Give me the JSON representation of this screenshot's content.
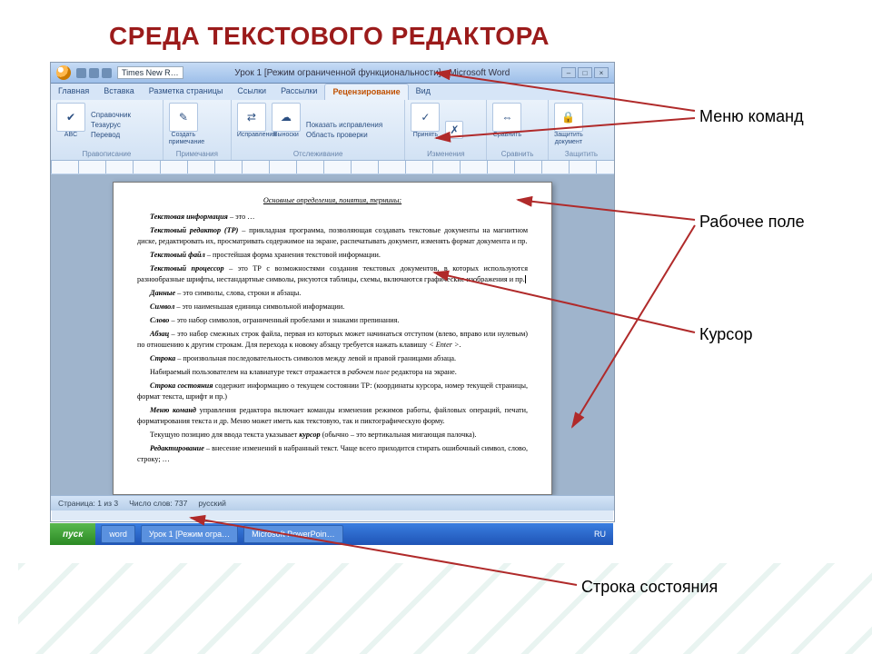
{
  "slide": {
    "title": "СРЕДА ТЕКСТОВОГО РЕДАКТОРА"
  },
  "titlebar": {
    "font_box": "Times New R…",
    "caption": "Урок 1 [Режим ограниченной функциональности] - Microsoft Word"
  },
  "tabs": {
    "items": [
      "Главная",
      "Вставка",
      "Разметка страницы",
      "Ссылки",
      "Рассылки",
      "Рецензирование",
      "Вид"
    ],
    "selected_index": 5
  },
  "ribbon": {
    "groups": [
      {
        "label": "Правописание",
        "items": [
          "ABC",
          "Справочник",
          "Тезаурус",
          "Перевод"
        ]
      },
      {
        "label": "Примечания",
        "items": [
          "Создать примечание"
        ]
      },
      {
        "label": "Отслеживание",
        "items": [
          "Исправления",
          "Выноски",
          "Показать исправления",
          "Область проверки"
        ]
      },
      {
        "label": "Изменения",
        "items": [
          "Принять",
          "Отклонить"
        ]
      },
      {
        "label": "Сравнить",
        "items": [
          "Сравнить"
        ]
      },
      {
        "label": "Защитить",
        "items": [
          "Защитить документ"
        ]
      }
    ]
  },
  "document": {
    "title": "Основные определения, понятия, термины:",
    "paragraphs": [
      "<b><i>Текстовая информация</i></b> – это …",
      "<b><i>Текстовый редактор (ТР)</i></b> – прикладная программа, позволяющая создавать текстовые документы на магнитном диске, редактировать их, просматривать содержимое на экране, распечатывать документ, изменять формат документа и пр.",
      "<b><i>Текстовый файл</i></b> – простейшая форма хранения текстовой информации.",
      "<b><i>Текстовый процессор</i></b> – это ТР с возможностями создания текстовых документов, в которых используются разнообразные шрифты, нестандартные символы, рисуются таблицы, схемы, включаются графические изображения и пр.|",
      "<b><i>Данные</i></b> – это символы, слова, строки и абзацы.",
      "<b><i>Символ</i></b> – это наименьшая единица символьной информации.",
      "<b><i>Слово</i></b> – это набор символов, ограниченный пробелами и знаками препинания.",
      "<b><i>Абзац</i></b> – это набор смежных строк файла, первая из которых может начинаться отступом (влево, вправо или нулевым) по отношению к другим строкам. Для перехода к новому абзацу требуется нажать клавишу <i>&lt; Enter &gt;</i>.",
      "<b><i>Строка</i></b> – произвольная последовательность символов между левой и правой границами абзаца.",
      "Набираемый пользователем на клавиатуре текст отражается в <i>рабочем поле</i> редактора на экране.",
      "<b><i>Строка состояния</i></b> содержит информацию о текущем состоянии ТР: (координаты курсора, номер текущей страницы, формат текста, шрифт и пр.)",
      "<b><i>Меню команд</i></b> управления редактора включает команды изменения режимов работы, файловых операций, печати, форматирования текста и др. Меню может иметь как текстовую, так и пиктографическую форму.",
      "Текущую позицию для ввода текста указывает <b><i>курсор</i></b> (обычно – это вертикальная мигающая палочка).",
      "<b><i>Редактирование</i></b> – внесение изменений в набранный текст. Чаще всего приходится стирать ошибочный символ, слово, строку; …"
    ]
  },
  "statusbar": {
    "page": "Страница: 1 из 3",
    "words": "Число слов: 737",
    "lang": "русский"
  },
  "taskbar": {
    "start": "пуск",
    "apps": [
      "word",
      "Урок 1 [Режим огра…",
      "Microsoft PowerPoin…"
    ],
    "tray": "RU"
  },
  "annotations": {
    "menu": "Меню команд",
    "workarea": "Рабочее поле",
    "cursor": "Курсор",
    "statusbar": "Строка состояния"
  }
}
